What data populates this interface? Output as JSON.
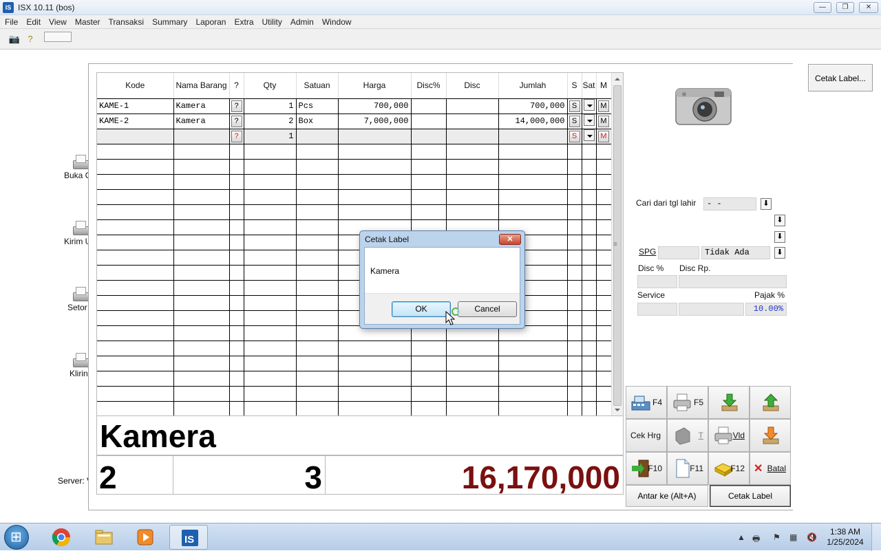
{
  "window": {
    "title": "ISX 10.11 (bos)",
    "app_icon": "IS"
  },
  "menu": [
    "File",
    "Edit",
    "View",
    "Master",
    "Transaksi",
    "Summary",
    "Laporan",
    "Extra",
    "Utility",
    "Admin",
    "Window"
  ],
  "side_items": [
    {
      "label": "Buka C",
      "icon": "printer-icon"
    },
    {
      "label": "Kirim U",
      "icon": "printer-icon"
    },
    {
      "label": "Setor",
      "icon": "printer-icon"
    },
    {
      "label": "Klirin",
      "icon": "printer-icon"
    }
  ],
  "server_label": "Server: V",
  "cetak_label_top": "Cetak Label...",
  "grid": {
    "headers": [
      "Kode",
      "Nama Barang",
      "?",
      "Qty",
      "Satuan",
      "Harga",
      "Disc%",
      "Disc",
      "Jumlah",
      "S",
      "Sat",
      "M"
    ],
    "rows": [
      {
        "kode": "KAME-1",
        "nama": "Kamera",
        "q": "?",
        "qty": "1",
        "satuan": "Pcs",
        "harga": "700,000",
        "discp": "",
        "disc": "",
        "jumlah": "700,000",
        "s": "S",
        "m": "M"
      },
      {
        "kode": "KAME-2",
        "nama": "Kamera",
        "q": "?",
        "qty": "2",
        "satuan": "Box",
        "harga": "7,000,000",
        "discp": "",
        "disc": "",
        "jumlah": "14,000,000",
        "s": "S",
        "m": "M"
      },
      {
        "kode": "",
        "nama": "",
        "q": "?",
        "qty": "1",
        "satuan": "",
        "harga": "",
        "discp": "",
        "disc": "",
        "jumlah": "",
        "s": "S",
        "m": "M"
      }
    ],
    "empty_rows": 18
  },
  "display": {
    "item_name": "Kamera",
    "count_items": "2",
    "count_qty": "3",
    "total": "16,170,000",
    "total_color": "#7a1010"
  },
  "right_form": {
    "cari_label": "Cari dari tgl lahir",
    "cari_value": "-   -",
    "spg_label": "SPG",
    "spg_value": "Tidak Ada",
    "disc_pct_label": "Disc %",
    "disc_rp_label": "Disc Rp.",
    "service_label": "Service",
    "pajak_label": "Pajak %",
    "pajak_value": "10.00%"
  },
  "function_keys": {
    "f4": "F4",
    "f5": "F5",
    "cek_hrg": "Cek Hrg",
    "t_label": "T",
    "vld": "Vld",
    "f10": "F10",
    "f11": "F11",
    "f12": "F12",
    "batal": "Batal",
    "antar": "Antar ke (Alt+A)",
    "cetak_label": "Cetak Label"
  },
  "dialog": {
    "title": "Cetak Label",
    "message": "Kamera",
    "ok": "OK",
    "cancel": "Cancel"
  },
  "taskbar": {
    "time": "1:38 AM",
    "date": "1/25/2024"
  }
}
